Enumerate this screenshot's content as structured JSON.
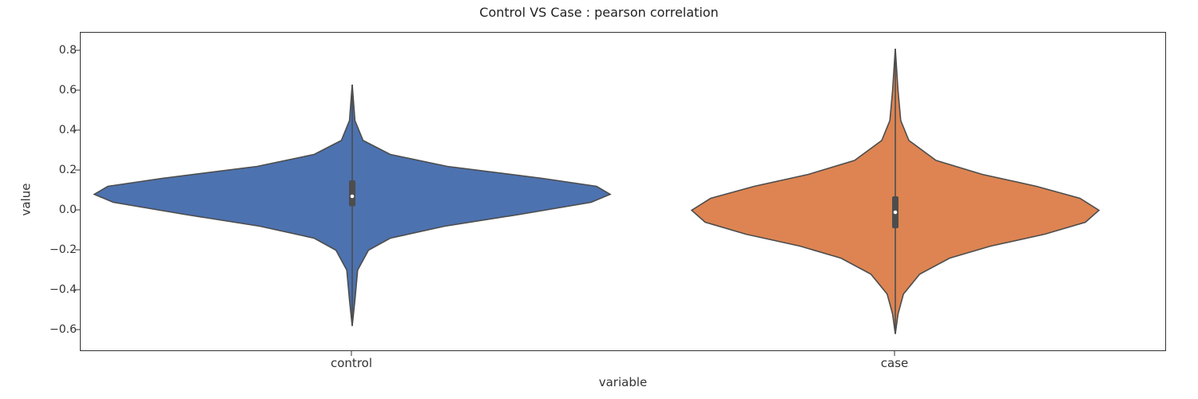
{
  "title": "Control VS Case : pearson correlation",
  "xlabel": "variable",
  "ylabel": "value",
  "yaxis": {
    "min": -0.71,
    "max": 0.89,
    "ticks": [
      -0.6,
      -0.4,
      -0.2,
      0.0,
      0.2,
      0.4,
      0.6,
      0.8
    ],
    "tick_labels": [
      "−0.6",
      "−0.4",
      "−0.2",
      "0.0",
      "0.2",
      "0.4",
      "0.6",
      "0.8"
    ]
  },
  "xaxis": {
    "categories": [
      "control",
      "case"
    ]
  },
  "colors": {
    "control": "#4c72b0",
    "case": "#dd8452",
    "outline": "#4d4d4d"
  },
  "chart_data": {
    "type": "violin",
    "title": "Control VS Case : pearson correlation",
    "xlabel": "variable",
    "ylabel": "value",
    "ylim": [
      -0.71,
      0.89
    ],
    "series": [
      {
        "name": "control",
        "color": "#4c72b0",
        "whisker_low": -0.58,
        "q1": 0.02,
        "median": 0.07,
        "q3": 0.15,
        "whisker_high": 0.63,
        "kde_peak_y": 0.08,
        "kde_half_width_at_peak": 0.95,
        "density_profile": [
          {
            "y": 0.63,
            "w": 0.0
          },
          {
            "y": 0.45,
            "w": 0.01
          },
          {
            "y": 0.35,
            "w": 0.04
          },
          {
            "y": 0.28,
            "w": 0.14
          },
          {
            "y": 0.22,
            "w": 0.35
          },
          {
            "y": 0.16,
            "w": 0.7
          },
          {
            "y": 0.12,
            "w": 0.9
          },
          {
            "y": 0.08,
            "w": 0.95
          },
          {
            "y": 0.04,
            "w": 0.88
          },
          {
            "y": -0.02,
            "w": 0.62
          },
          {
            "y": -0.08,
            "w": 0.34
          },
          {
            "y": -0.14,
            "w": 0.14
          },
          {
            "y": -0.2,
            "w": 0.06
          },
          {
            "y": -0.3,
            "w": 0.02
          },
          {
            "y": -0.45,
            "w": 0.01
          },
          {
            "y": -0.58,
            "w": 0.0
          }
        ]
      },
      {
        "name": "case",
        "color": "#dd8452",
        "whisker_low": -0.62,
        "q1": -0.09,
        "median": -0.01,
        "q3": 0.07,
        "whisker_high": 0.81,
        "kde_peak_y": 0.0,
        "kde_half_width_at_peak": 0.75,
        "density_profile": [
          {
            "y": 0.81,
            "w": 0.0
          },
          {
            "y": 0.6,
            "w": 0.01
          },
          {
            "y": 0.45,
            "w": 0.02
          },
          {
            "y": 0.35,
            "w": 0.05
          },
          {
            "y": 0.25,
            "w": 0.15
          },
          {
            "y": 0.18,
            "w": 0.32
          },
          {
            "y": 0.12,
            "w": 0.52
          },
          {
            "y": 0.06,
            "w": 0.68
          },
          {
            "y": 0.0,
            "w": 0.75
          },
          {
            "y": -0.06,
            "w": 0.7
          },
          {
            "y": -0.12,
            "w": 0.55
          },
          {
            "y": -0.18,
            "w": 0.35
          },
          {
            "y": -0.24,
            "w": 0.2
          },
          {
            "y": -0.32,
            "w": 0.09
          },
          {
            "y": -0.42,
            "w": 0.03
          },
          {
            "y": -0.52,
            "w": 0.01
          },
          {
            "y": -0.62,
            "w": 0.0
          }
        ]
      }
    ]
  }
}
